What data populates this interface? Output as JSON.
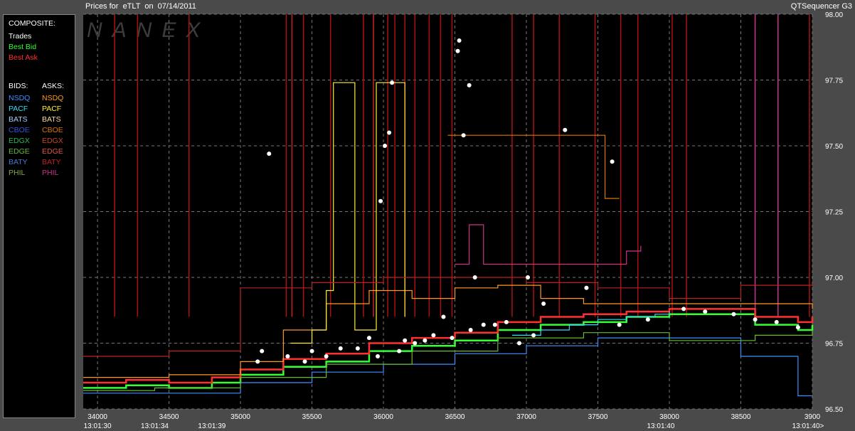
{
  "window": {
    "title_left": "Prices for  eTLT  on  07/14/2011",
    "title_right": "QTSequencer G3",
    "watermark": "NANEX"
  },
  "legend": {
    "composite_heading": "COMPOSITE:",
    "composite": [
      {
        "label": "Trades",
        "color": "#ffffff"
      },
      {
        "label": "Best Bid",
        "color": "#33ff33"
      },
      {
        "label": "Best Ask",
        "color": "#ff3030"
      }
    ],
    "bids_heading": "BIDS:",
    "asks_heading": "ASKS:",
    "bids": [
      {
        "label": "NSDQ",
        "color": "#3f8fff"
      },
      {
        "label": "PACF",
        "color": "#33ddff"
      },
      {
        "label": "BATS",
        "color": "#aaccff"
      },
      {
        "label": "CBOE",
        "color": "#3355dd"
      },
      {
        "label": "EDGX",
        "color": "#22bb55"
      },
      {
        "label": "EDGE",
        "color": "#66bb33"
      },
      {
        "label": "BATY",
        "color": "#4477cc"
      },
      {
        "label": "PHIL",
        "color": "#88aa44"
      }
    ],
    "asks": [
      {
        "label": "NSDQ",
        "color": "#ff9922"
      },
      {
        "label": "PACF",
        "color": "#ffee33"
      },
      {
        "label": "BATS",
        "color": "#ffdd99"
      },
      {
        "label": "CBOE",
        "color": "#dd7700"
      },
      {
        "label": "EDGX",
        "color": "#cc4422"
      },
      {
        "label": "EDGE",
        "color": "#dd5544"
      },
      {
        "label": "BATY",
        "color": "#bb2222"
      },
      {
        "label": "PHIL",
        "color": "#cc3388"
      }
    ]
  },
  "chart_data": {
    "type": "scatter",
    "title": "Prices for  eTLT  on  07/14/2011",
    "xlim": [
      33900,
      39000
    ],
    "ylim": [
      96.5,
      98.0
    ],
    "x_ticks": [
      "34000",
      "34500",
      "35000",
      "35500",
      "36000",
      "36500",
      "37000",
      "37500",
      "38000",
      "38500",
      "3900"
    ],
    "x_tick_values": [
      34000,
      34500,
      35000,
      35500,
      36000,
      36500,
      37000,
      37500,
      38000,
      38500,
      39000
    ],
    "time_labels": [
      {
        "x": 34000,
        "label": "13:01:30"
      },
      {
        "x": 34400,
        "label": "13:01:34"
      },
      {
        "x": 34800,
        "label": "13:01:39"
      },
      {
        "x": 37940,
        "label": "13:01:40"
      },
      {
        "x": 38970,
        "label": "13:01:40>"
      }
    ],
    "y_ticks": [
      "96.50",
      "96.75",
      "97.00",
      "97.25",
      "97.50",
      "97.75",
      "98.00"
    ],
    "y_tick_values": [
      96.5,
      96.75,
      97.0,
      97.25,
      97.5,
      97.75,
      98.0
    ],
    "grid": true,
    "series": [
      {
        "name": "Best Bid",
        "color": "#33ff33",
        "x": [
          33900,
          34200,
          34500,
          34800,
          35000,
          35300,
          35600,
          35900,
          36200,
          36500,
          36800,
          37100,
          37400,
          37700,
          38000,
          38300,
          38600,
          38900,
          39000
        ],
        "y": [
          96.58,
          96.59,
          96.58,
          96.6,
          96.63,
          96.66,
          96.68,
          96.72,
          96.74,
          96.76,
          96.8,
          96.82,
          96.83,
          96.85,
          96.86,
          96.86,
          96.82,
          96.8,
          96.82
        ]
      },
      {
        "name": "Best Ask",
        "color": "#ff3030",
        "x": [
          33900,
          34200,
          34500,
          34800,
          35000,
          35300,
          35600,
          35900,
          36200,
          36500,
          36800,
          37100,
          37400,
          37700,
          38000,
          38300,
          38600,
          38900,
          39000
        ],
        "y": [
          96.6,
          96.61,
          96.6,
          96.62,
          96.65,
          96.69,
          96.71,
          96.75,
          96.77,
          96.79,
          96.83,
          96.85,
          96.86,
          96.87,
          96.88,
          96.88,
          96.85,
          96.83,
          96.85
        ]
      },
      {
        "name": "Trades",
        "color": "#ffffff",
        "x": [
          35120,
          35150,
          35200,
          35330,
          35450,
          35500,
          35600,
          35700,
          35820,
          35900,
          35960,
          35980,
          36010,
          36040,
          36060,
          36110,
          36150,
          36220,
          36290,
          36350,
          36420,
          36480,
          36520,
          36530,
          36560,
          36600,
          36610,
          36640,
          36700,
          36780,
          36860,
          36950,
          37010,
          37050,
          37120,
          37270,
          37420,
          37600,
          37650,
          37850,
          38100,
          38250,
          38450,
          38600,
          38750,
          38900
        ],
        "y": [
          96.68,
          96.72,
          97.47,
          96.7,
          96.68,
          96.72,
          96.7,
          96.73,
          96.73,
          96.77,
          96.7,
          97.29,
          97.5,
          97.55,
          97.74,
          96.72,
          96.76,
          96.75,
          96.76,
          96.78,
          96.85,
          96.77,
          97.86,
          97.9,
          97.54,
          97.73,
          96.8,
          97.0,
          96.82,
          96.82,
          96.83,
          96.75,
          97.0,
          96.78,
          96.9,
          97.56,
          96.96,
          97.44,
          96.82,
          96.84,
          96.88,
          96.87,
          96.86,
          96.84,
          96.83,
          96.81
        ]
      },
      {
        "name": "NSDQ",
        "color": "#3f8fff",
        "x": [
          33900,
          34500,
          35000,
          35500,
          36000,
          36500,
          37000,
          37500,
          38000,
          38500,
          38900,
          39000
        ],
        "y": [
          96.56,
          96.56,
          96.6,
          96.64,
          96.67,
          96.71,
          96.74,
          96.77,
          96.77,
          96.7,
          96.55,
          96.55
        ]
      },
      {
        "name": "PACF",
        "color": "#33ddff",
        "x": [
          36900,
          37100,
          37300,
          37500,
          37700,
          37900,
          38000
        ],
        "y": [
          96.78,
          96.8,
          96.82,
          96.84,
          96.85,
          96.86,
          96.87
        ]
      },
      {
        "name": "EDGE",
        "color": "#66bb33",
        "x": [
          33900,
          34400,
          35000,
          35600,
          36200,
          36800,
          37400,
          38000,
          38600,
          39000
        ],
        "y": [
          96.57,
          96.58,
          96.62,
          96.67,
          96.72,
          96.77,
          96.79,
          96.76,
          96.78,
          96.8
        ]
      },
      {
        "name": "NSDQ",
        "color": "#ff9922",
        "x": [
          33900,
          34500,
          35000,
          35300,
          35600,
          35900,
          36200,
          36500,
          36800,
          37100,
          37400,
          37700,
          38000,
          38500,
          39000
        ],
        "y": [
          96.62,
          96.63,
          96.68,
          96.8,
          96.9,
          96.95,
          96.92,
          96.96,
          96.97,
          96.92,
          96.9,
          96.9,
          96.9,
          96.9,
          96.88
        ]
      },
      {
        "name": "PACF",
        "color": "#ffee33",
        "x": [
          35350,
          35500,
          35600,
          35650,
          35750,
          35800,
          35900,
          35950,
          36050,
          36150
        ],
        "y": [
          96.75,
          96.8,
          96.95,
          97.74,
          97.74,
          96.8,
          96.8,
          97.74,
          97.74,
          96.85
        ]
      },
      {
        "name": "CBOE",
        "color": "#dd7700",
        "x": [
          36450,
          36600,
          36800,
          37000,
          37200,
          37400,
          37500,
          37550,
          37650
        ],
        "y": [
          97.54,
          97.54,
          97.54,
          97.54,
          97.54,
          97.54,
          97.54,
          97.3,
          97.3
        ]
      },
      {
        "name": "BATY",
        "color": "#bb2222",
        "x": [
          33900,
          34500,
          35000,
          35500,
          36000,
          36500,
          37000,
          37500,
          38000,
          38500,
          39000
        ],
        "y": [
          96.7,
          96.72,
          96.96,
          96.98,
          97.0,
          97.0,
          96.98,
          96.96,
          96.92,
          96.97,
          96.98
        ]
      },
      {
        "name": "PHIL",
        "color": "#cc3388",
        "x": [
          36500,
          36600,
          36700,
          37700,
          37800
        ],
        "y": [
          97.05,
          97.2,
          97.05,
          97.1,
          97.12
        ]
      }
    ],
    "spikes": [
      {
        "x": 34120,
        "color": "#aa1111"
      },
      {
        "x": 34280,
        "color": "#aa1111"
      },
      {
        "x": 34640,
        "color": "#aa1111"
      },
      {
        "x": 35320,
        "color": "#aa1111"
      },
      {
        "x": 35360,
        "color": "#cc2222"
      },
      {
        "x": 35440,
        "color": "#aa1111"
      },
      {
        "x": 35630,
        "color": "#aa1111"
      },
      {
        "x": 35860,
        "color": "#aa1111"
      },
      {
        "x": 35930,
        "color": "#cc2222"
      },
      {
        "x": 36030,
        "color": "#aa1111"
      },
      {
        "x": 36080,
        "color": "#aa1111"
      },
      {
        "x": 36150,
        "color": "#aa1111"
      },
      {
        "x": 36220,
        "color": "#aa1111"
      },
      {
        "x": 36320,
        "color": "#aa1111"
      },
      {
        "x": 36400,
        "color": "#aa1111"
      },
      {
        "x": 36480,
        "color": "#aa1111"
      },
      {
        "x": 36900,
        "color": "#aa1111"
      },
      {
        "x": 37050,
        "color": "#aa1111"
      },
      {
        "x": 37230,
        "color": "#aa1111"
      },
      {
        "x": 37480,
        "color": "#aa1111"
      },
      {
        "x": 37660,
        "color": "#aa1111"
      },
      {
        "x": 37780,
        "color": "#aa1111"
      },
      {
        "x": 38020,
        "color": "#aa1111"
      },
      {
        "x": 38120,
        "color": "#aa1111"
      },
      {
        "x": 38600,
        "color": "#cc3388"
      },
      {
        "x": 38760,
        "color": "#cc3388"
      },
      {
        "x": 38980,
        "color": "#aa1111"
      }
    ]
  }
}
